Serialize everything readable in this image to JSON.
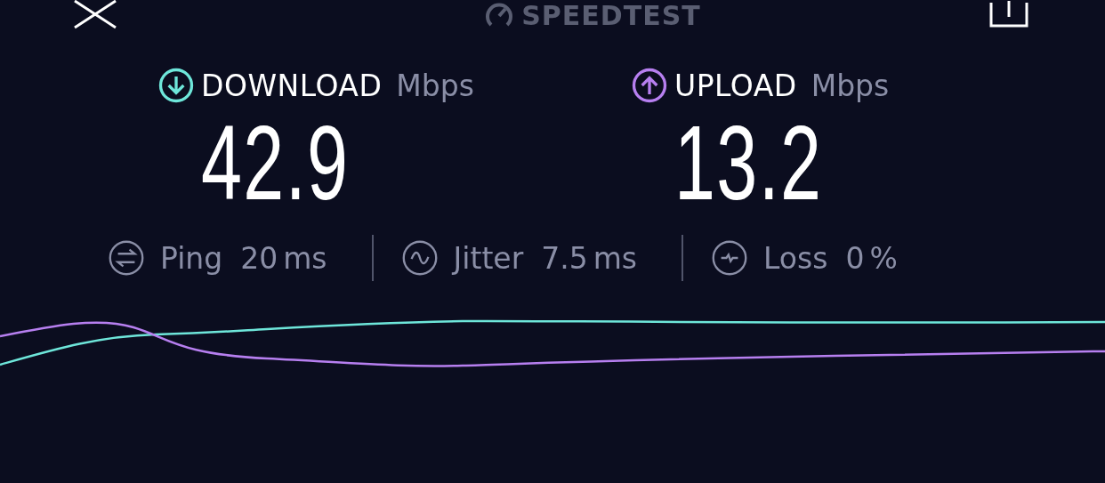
{
  "header": {
    "title": "SPEEDTEST"
  },
  "results": [
    {
      "kind": "download",
      "label": "DOWNLOAD",
      "unit": "Mbps",
      "value": "42.9",
      "color": "#6ee6da"
    },
    {
      "kind": "upload",
      "label": "UPLOAD",
      "unit": "Mbps",
      "value": "13.2",
      "color": "#b77ff0"
    }
  ],
  "stats": [
    {
      "kind": "ping",
      "label": "Ping",
      "value": "20",
      "unit": "ms"
    },
    {
      "kind": "jitter",
      "label": "Jitter",
      "value": "7.5",
      "unit": "ms"
    },
    {
      "kind": "loss",
      "label": "Loss",
      "value": "0",
      "unit": "%"
    }
  ]
}
